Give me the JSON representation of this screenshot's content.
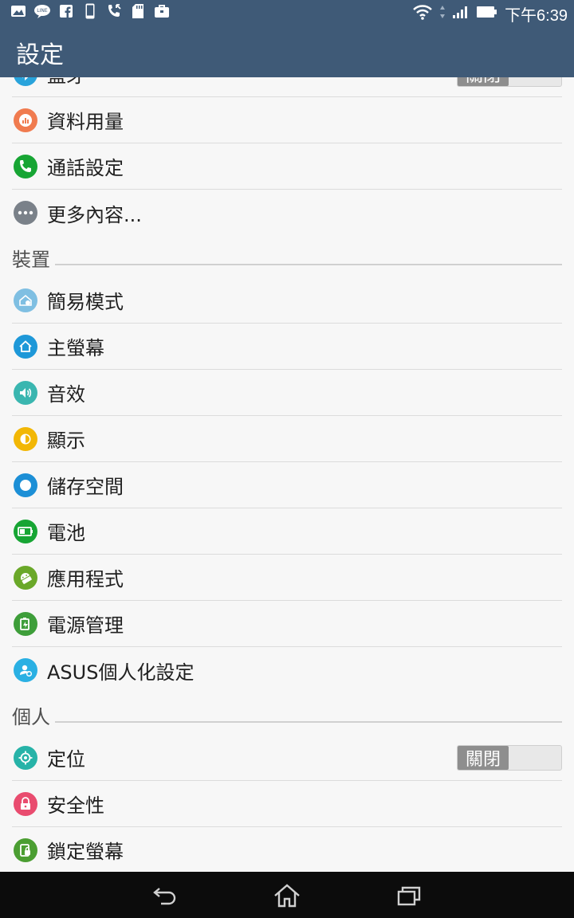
{
  "status_bar": {
    "time": "下午6:39",
    "left_icons": [
      "gallery-icon",
      "line-icon",
      "facebook-icon",
      "phone-device-icon",
      "call-icon",
      "sd-card-icon",
      "briefcase-icon"
    ]
  },
  "header": {
    "title": "設定"
  },
  "items_top": [
    {
      "key": "bluetooth",
      "label": "藍牙",
      "icon": "bluetooth-icon",
      "color": "#29a3db",
      "toggle": "關閉"
    },
    {
      "key": "data-usage",
      "label": "資料用量",
      "icon": "data-usage-icon",
      "color": "#f07b4f"
    },
    {
      "key": "call-settings",
      "label": "通話設定",
      "icon": "phone-icon",
      "color": "#17a534"
    },
    {
      "key": "more",
      "label": "更多內容...",
      "icon": "more-icon",
      "color": "#7a8189"
    }
  ],
  "sections": {
    "device": "裝置",
    "personal": "個人"
  },
  "items_device": [
    {
      "key": "easy-mode",
      "label": "簡易模式",
      "icon": "easy-mode-icon",
      "color": "#7fbfe2"
    },
    {
      "key": "home-screen",
      "label": "主螢幕",
      "icon": "home-icon",
      "color": "#1e98d8"
    },
    {
      "key": "sound",
      "label": "音效",
      "icon": "speaker-icon",
      "color": "#3ab6b0"
    },
    {
      "key": "display",
      "label": "顯示",
      "icon": "brightness-icon",
      "color": "#f2b705"
    },
    {
      "key": "storage",
      "label": "儲存空間",
      "icon": "storage-icon",
      "color": "#1c8fd6"
    },
    {
      "key": "battery",
      "label": "電池",
      "icon": "battery-icon",
      "color": "#17a534"
    },
    {
      "key": "apps",
      "label": "應用程式",
      "icon": "android-icon",
      "color": "#6aa829"
    },
    {
      "key": "power-management",
      "label": "電源管理",
      "icon": "power-management-icon",
      "color": "#3e9e3a"
    },
    {
      "key": "asus-customized",
      "label": "ASUS個人化設定",
      "icon": "asus-custom-icon",
      "color": "#2ab0e3"
    }
  ],
  "items_personal": [
    {
      "key": "location",
      "label": "定位",
      "icon": "location-icon",
      "color": "#27b3a8",
      "toggle": "關閉"
    },
    {
      "key": "security",
      "label": "安全性",
      "icon": "lock-icon",
      "color": "#e94c6f"
    },
    {
      "key": "lock-screen",
      "label": "鎖定螢幕",
      "icon": "lock-screen-icon",
      "color": "#4b9e32"
    }
  ],
  "nav": [
    "back-icon",
    "home-nav-icon",
    "recent-apps-icon"
  ]
}
